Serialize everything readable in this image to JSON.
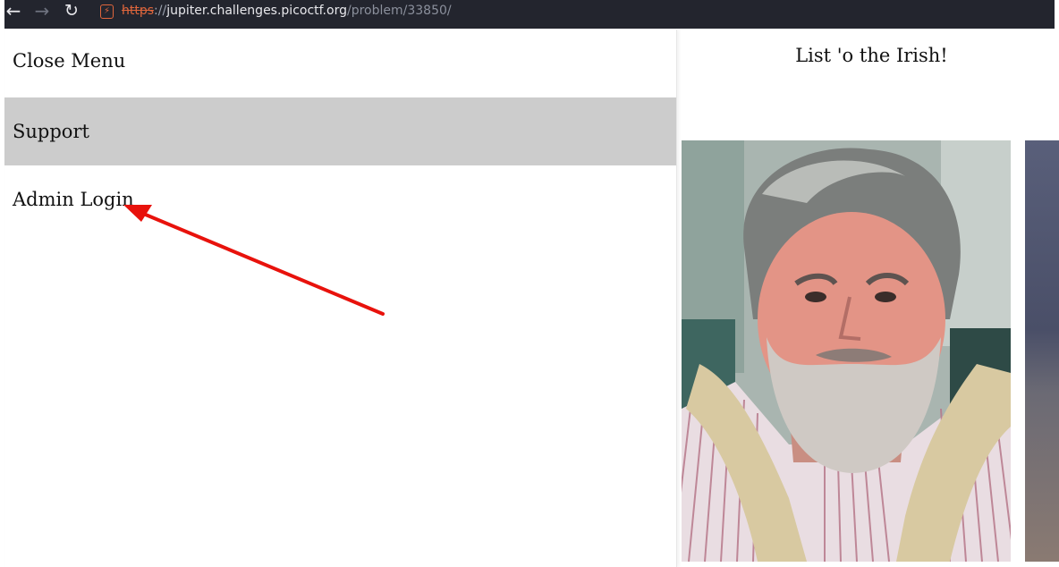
{
  "browser": {
    "back_icon": "←",
    "forward_icon": "→",
    "reload_icon": "↻",
    "insecure_icon": "⚡",
    "url_scheme": "https",
    "url_sep": "://",
    "url_host": "jupiter.challenges.picoctf.org",
    "url_path": "/problem/33850/"
  },
  "menu": {
    "close_label": "Close Menu",
    "support_label": "Support",
    "admin_label": "Admin Login"
  },
  "content": {
    "heading": "List 'o the Irish!"
  },
  "colors": {
    "browser_bar": "#23252e",
    "menu_hover": "#cccccc",
    "arrow": "#e8120c",
    "insecure": "#e0663c"
  }
}
